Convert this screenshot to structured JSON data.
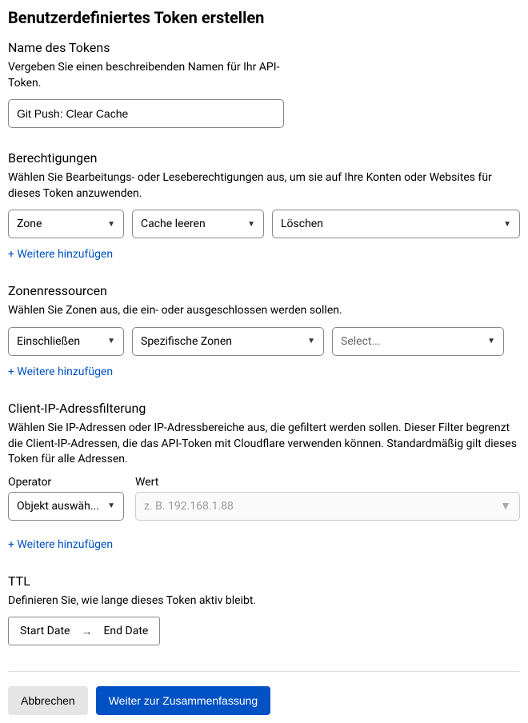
{
  "page_title": "Benutzerdefiniertes Token erstellen",
  "token_name": {
    "title": "Name des Tokens",
    "desc": "Vergeben Sie einen beschreibenden Namen für Ihr API-Token.",
    "value": "Git Push: Clear Cache"
  },
  "permissions": {
    "title": "Berechtigungen",
    "desc": "Wählen Sie Bearbeitungs- oder Leseberechtigungen aus, um sie auf Ihre Konten oder Websites für dieses Token anzuwenden.",
    "col1": "Zone",
    "col2": "Cache leeren",
    "col3": "Löschen",
    "add": "+ Weitere hinzufügen"
  },
  "zones": {
    "title": "Zonenressourcen",
    "desc": "Wählen Sie Zonen aus, die ein- oder ausgeschlossen werden sollen.",
    "col1": "Einschließen",
    "col2": "Spezifische Zonen",
    "col3": "Select...",
    "add": "+ Weitere hinzufügen"
  },
  "ip": {
    "title": "Client-IP-Adressfilterung",
    "desc": "Wählen Sie IP-Adressen oder IP-Adressbereiche aus, die gefiltert werden sollen. Dieser Filter begrenzt die Client-IP-Adressen, die das API-Token mit Cloudflare verwenden können. Standardmäßig gilt dieses Token für alle Adressen.",
    "op_label": "Operator",
    "val_label": "Wert",
    "op_value": "Objekt auswäh...",
    "val_placeholder": "z. B. 192.168.1.88",
    "add": "+ Weitere hinzufügen"
  },
  "ttl": {
    "title": "TTL",
    "desc": "Definieren Sie, wie lange dieses Token aktiv bleibt.",
    "start": "Start Date",
    "end": "End Date"
  },
  "footer": {
    "cancel": "Abbrechen",
    "continue": "Weiter zur Zusammenfassung"
  }
}
